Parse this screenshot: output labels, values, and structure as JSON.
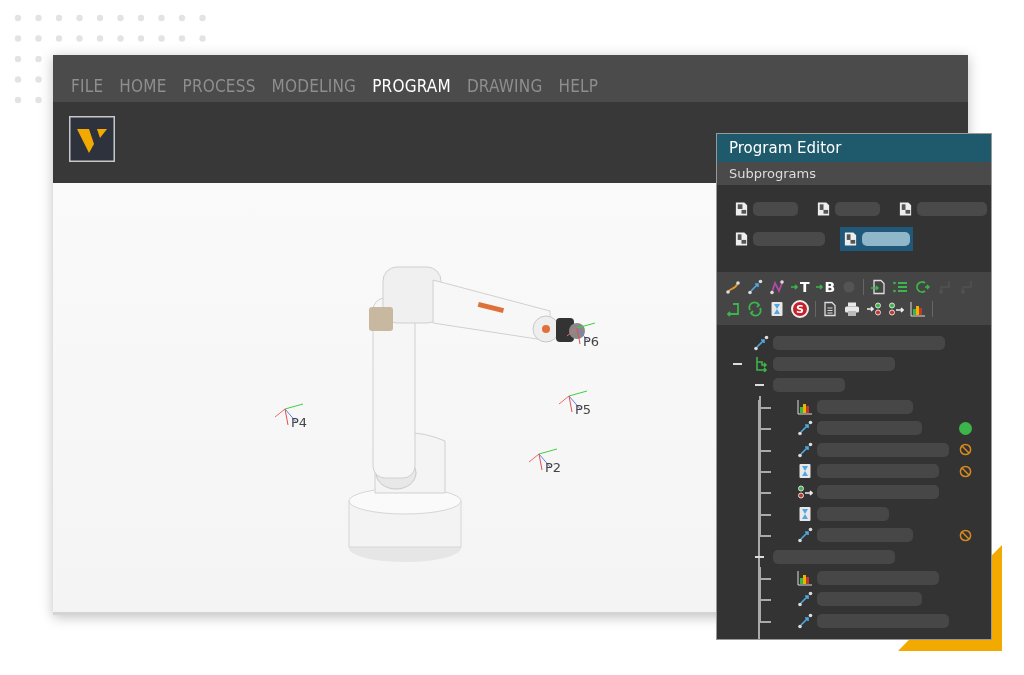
{
  "menu": [
    {
      "label": "FILE",
      "selected": false
    },
    {
      "label": "HOME",
      "selected": false
    },
    {
      "label": "PROCESS",
      "selected": false
    },
    {
      "label": "MODELING",
      "selected": false
    },
    {
      "label": "PROGRAM",
      "selected": true
    },
    {
      "label": "DRAWING",
      "selected": false
    },
    {
      "label": "HELP",
      "selected": false
    }
  ],
  "viewport": {
    "points": [
      {
        "label": "P6"
      },
      {
        "label": "P5"
      },
      {
        "label": "P4"
      },
      {
        "label": "P2"
      }
    ]
  },
  "program_editor": {
    "title": "Program Editor",
    "section": "Subprograms",
    "subprograms": [
      {
        "kind": "main",
        "selected": false
      },
      {
        "kind": "sub",
        "selected": false
      },
      {
        "kind": "sub",
        "selected": false
      },
      {
        "kind": "sub",
        "selected": false
      },
      {
        "kind": "sub",
        "selected": true
      }
    ],
    "toolbar": [
      [
        {
          "kind": "spline-move",
          "disabled": false
        },
        {
          "kind": "linear-move",
          "disabled": false
        },
        {
          "kind": "curve-move",
          "disabled": false
        },
        {
          "kind": "tool-frame",
          "label": "T",
          "disabled": false
        },
        {
          "kind": "base-frame",
          "label": "B",
          "disabled": false
        },
        {
          "kind": "record",
          "disabled": true
        },
        {
          "kind": "separator"
        },
        {
          "kind": "call-subprogram",
          "disabled": false
        },
        {
          "kind": "list",
          "disabled": false
        },
        {
          "kind": "loop",
          "disabled": false
        },
        {
          "kind": "branch-in",
          "disabled": true
        },
        {
          "kind": "branch-out",
          "disabled": true
        }
      ],
      [
        {
          "kind": "return",
          "disabled": false
        },
        {
          "kind": "refresh",
          "disabled": false
        },
        {
          "kind": "wait",
          "disabled": false
        },
        {
          "kind": "stop",
          "label": "S",
          "disabled": false
        },
        {
          "kind": "separator"
        },
        {
          "kind": "document",
          "disabled": false
        },
        {
          "kind": "print",
          "disabled": false
        },
        {
          "kind": "set-output",
          "disabled": false
        },
        {
          "kind": "wait-input",
          "disabled": false
        },
        {
          "kind": "chart",
          "disabled": false
        },
        {
          "kind": "separator"
        }
      ]
    ],
    "tree": [
      {
        "kind": "linear"
      },
      {
        "kind": "branch",
        "expanded": true,
        "children": [
          {
            "kind": "group",
            "expanded": true,
            "children": [
              {
                "kind": "chart",
                "reached": false,
                "blocked": false
              },
              {
                "kind": "linear",
                "reached": true,
                "blocked": false
              },
              {
                "kind": "linear",
                "reached": false,
                "blocked": true
              },
              {
                "kind": "wait",
                "reached": false,
                "blocked": true
              },
              {
                "kind": "io",
                "reached": false,
                "blocked": false
              },
              {
                "kind": "wait",
                "reached": false,
                "blocked": false
              },
              {
                "kind": "linear",
                "reached": false,
                "blocked": true
              }
            ]
          },
          {
            "kind": "group",
            "expanded": true,
            "children": [
              {
                "kind": "chart",
                "reached": false,
                "blocked": false
              },
              {
                "kind": "linear",
                "reached": false,
                "blocked": false
              },
              {
                "kind": "linear",
                "reached": false,
                "blocked": false
              }
            ]
          }
        ]
      }
    ]
  }
}
